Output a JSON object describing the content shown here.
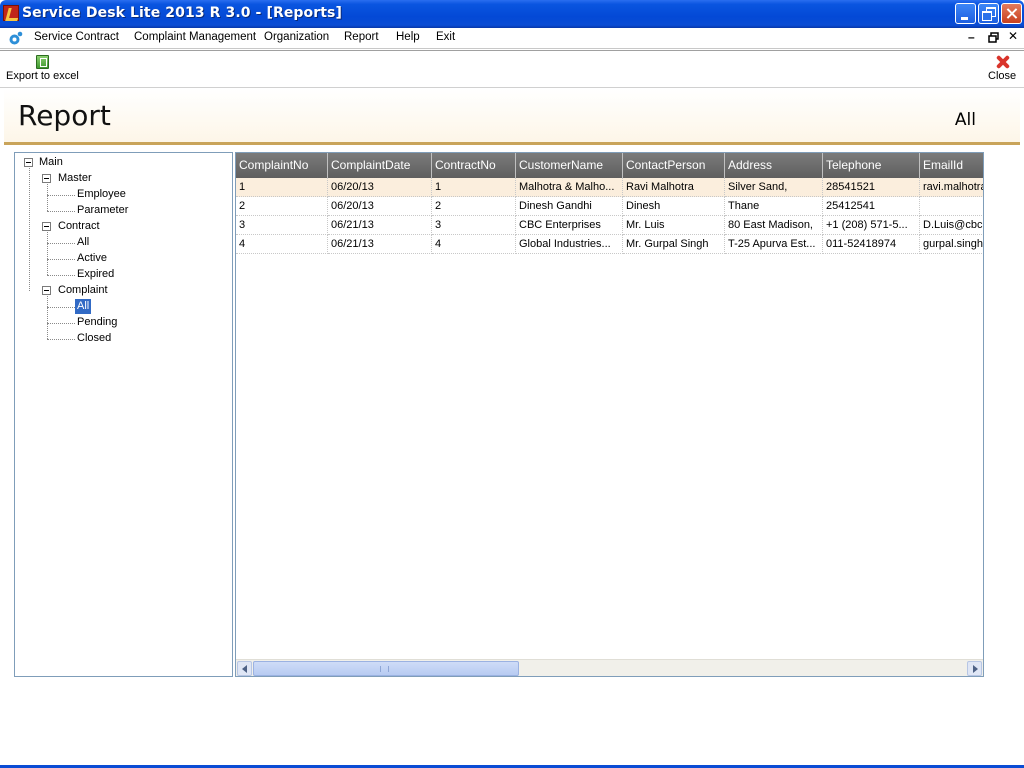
{
  "window": {
    "title": "Service Desk Lite 2013 R 3.0 - [Reports]"
  },
  "menu": {
    "items": [
      "Service Contract",
      "Complaint Management",
      "Organization",
      "Report",
      "Help",
      "Exit"
    ]
  },
  "toolbar": {
    "export_label": "Export to excel",
    "close_label": "Close"
  },
  "header": {
    "title": "Report",
    "filter": "All"
  },
  "tree": {
    "root": "Main",
    "groups": [
      {
        "label": "Master",
        "children": [
          "Employee",
          "Parameter"
        ]
      },
      {
        "label": "Contract",
        "children": [
          "All",
          "Active",
          "Expired"
        ]
      },
      {
        "label": "Complaint",
        "children": [
          "All",
          "Pending",
          "Closed"
        ]
      }
    ],
    "selected": "Complaint/All"
  },
  "grid": {
    "columns": [
      "ComplaintNo",
      "ComplaintDate",
      "ContractNo",
      "CustomerName",
      "ContactPerson",
      "Address",
      "Telephone",
      "EmailId"
    ],
    "rows": [
      [
        "1",
        "06/20/13",
        "1",
        "Malhotra  &  Malho...",
        "Ravi Malhotra",
        "Silver Sand,",
        "28541521",
        "ravi.malhotra"
      ],
      [
        "2",
        "06/20/13",
        "2",
        "Dinesh Gandhi",
        "Dinesh",
        "Thane",
        "25412541",
        ""
      ],
      [
        "3",
        "06/21/13",
        "3",
        "CBC Enterprises",
        "Mr. Luis",
        "80 East Madison,",
        "+1 (208) 571-5...",
        "D.Luis@cbce"
      ],
      [
        "4",
        "06/21/13",
        "4",
        "Global  Industries...",
        "Mr. Gurpal Singh",
        "T-25 Apurva Est...",
        "011-52418974",
        "gurpal.singh"
      ]
    ]
  }
}
